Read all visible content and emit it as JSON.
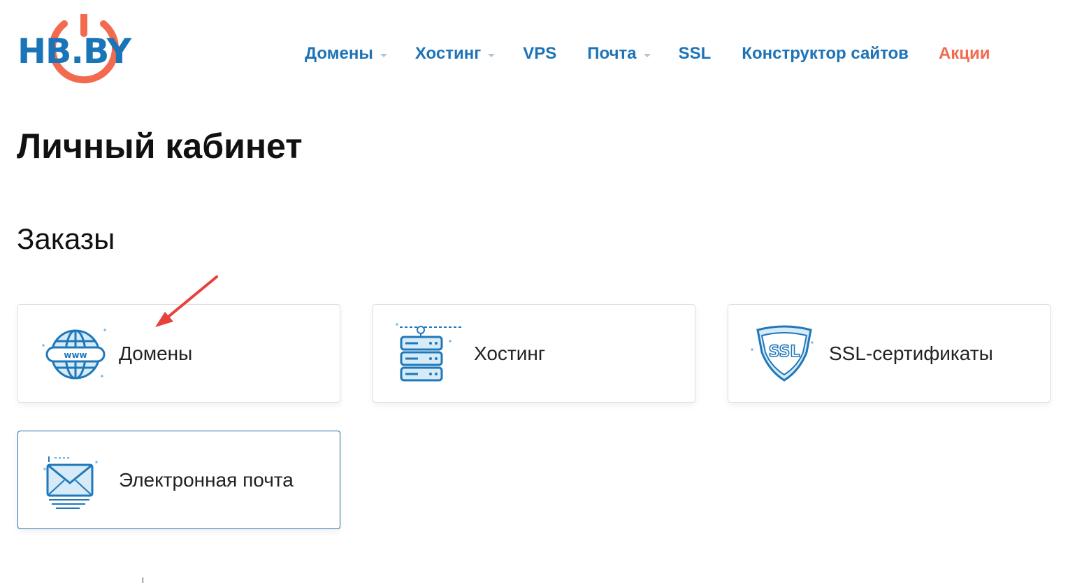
{
  "brand": {
    "logo_text": "HB.BY",
    "primary": "#1a74b8",
    "accent": "#f26b4e"
  },
  "nav": {
    "items": [
      {
        "label": "Домены",
        "has_dropdown": true
      },
      {
        "label": "Хостинг",
        "has_dropdown": true
      },
      {
        "label": "VPS",
        "has_dropdown": false
      },
      {
        "label": "Почта",
        "has_dropdown": true
      },
      {
        "label": "SSL",
        "has_dropdown": false
      },
      {
        "label": "Конструктор сайтов",
        "has_dropdown": false
      },
      {
        "label": "Акции",
        "has_dropdown": false,
        "highlight": true
      }
    ]
  },
  "page": {
    "title": "Личный кабинет",
    "section_title": "Заказы"
  },
  "cards": [
    {
      "label": "Домены",
      "icon": "globe-www-icon"
    },
    {
      "label": "Хостинг",
      "icon": "server-rack-icon"
    },
    {
      "label": "SSL-сертификаты",
      "icon": "ssl-shield-icon"
    },
    {
      "label": "Электронная почта",
      "icon": "envelope-icon",
      "active": true
    }
  ],
  "annotation": {
    "icon": "red-arrow-icon",
    "color": "#e8413a"
  }
}
